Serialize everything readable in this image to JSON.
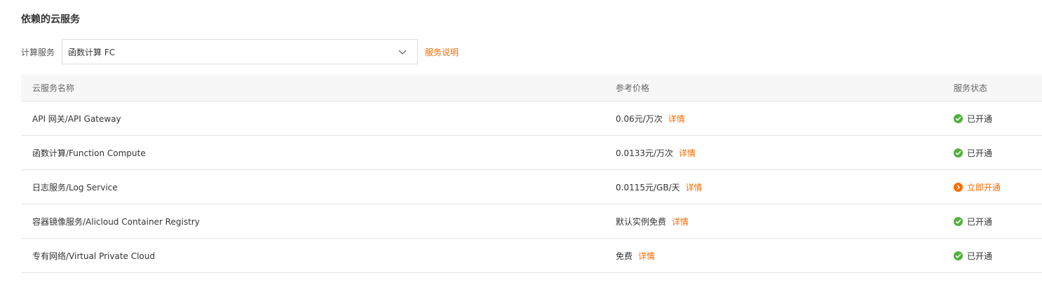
{
  "section": {
    "title": "依赖的云服务"
  },
  "compute": {
    "label": "计算服务",
    "selected": "函数计算 FC",
    "link_label": "服务说明"
  },
  "table": {
    "headers": {
      "name": "云服务名称",
      "price": "参考价格",
      "status": "服务状态"
    },
    "rows": [
      {
        "name": "API 网关/API Gateway",
        "price": "0.06元/万次",
        "detail": "详情",
        "status": "已开通",
        "state": "enabled"
      },
      {
        "name": "函数计算/Function Compute",
        "price": "0.0133元/万次",
        "detail": "详情",
        "status": "已开通",
        "state": "enabled"
      },
      {
        "name": "日志服务/Log Service",
        "price": "0.0115元/GB/天",
        "detail": "详情",
        "status": "立即开通",
        "state": "activate"
      },
      {
        "name": "容器镜像服务/Alicloud Container Registry",
        "price": "默认实例免费",
        "detail": "详情",
        "status": "已开通",
        "state": "enabled"
      },
      {
        "name": "专有网络/Virtual Private Cloud",
        "price": "免费",
        "detail": "详情",
        "status": "已开通",
        "state": "enabled"
      }
    ]
  },
  "colors": {
    "accent": "#ff6a00",
    "success": "#52b03d",
    "border": "#e5e5e5",
    "header_bg": "#f7f7f7"
  },
  "icons": {
    "enabled": "check-circle-icon",
    "activate": "arrow-right-circle-icon",
    "select": "chevron-down-icon"
  }
}
